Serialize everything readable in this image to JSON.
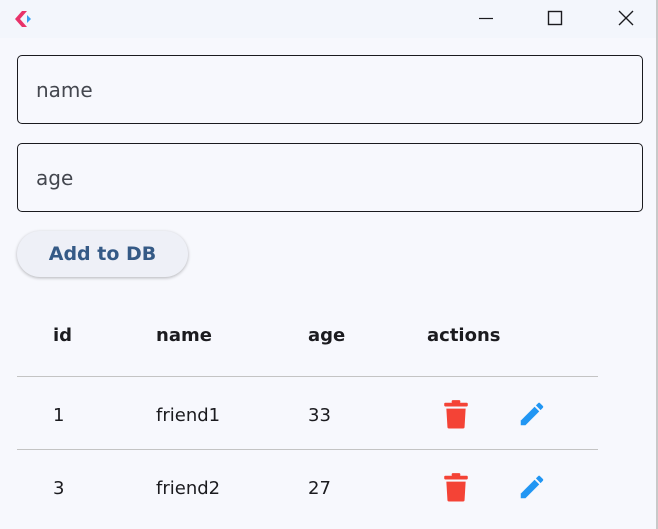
{
  "form": {
    "name_placeholder": "name",
    "age_placeholder": "age",
    "add_label": "Add to DB"
  },
  "table": {
    "headers": {
      "id": "id",
      "name": "name",
      "age": "age",
      "actions": "actions"
    },
    "rows": [
      {
        "id": "1",
        "name": "friend1",
        "age": "33"
      },
      {
        "id": "3",
        "name": "friend2",
        "age": "27"
      }
    ]
  },
  "icons": {
    "app": "flutter-app-icon",
    "minimize": "minimize-icon",
    "maximize": "maximize-icon",
    "close": "close-icon",
    "delete": "trash-icon",
    "edit": "pencil-icon"
  },
  "colors": {
    "accent": "#355a86",
    "delete": "#f44336",
    "edit": "#2196f3",
    "background": "#f7f8fd"
  }
}
